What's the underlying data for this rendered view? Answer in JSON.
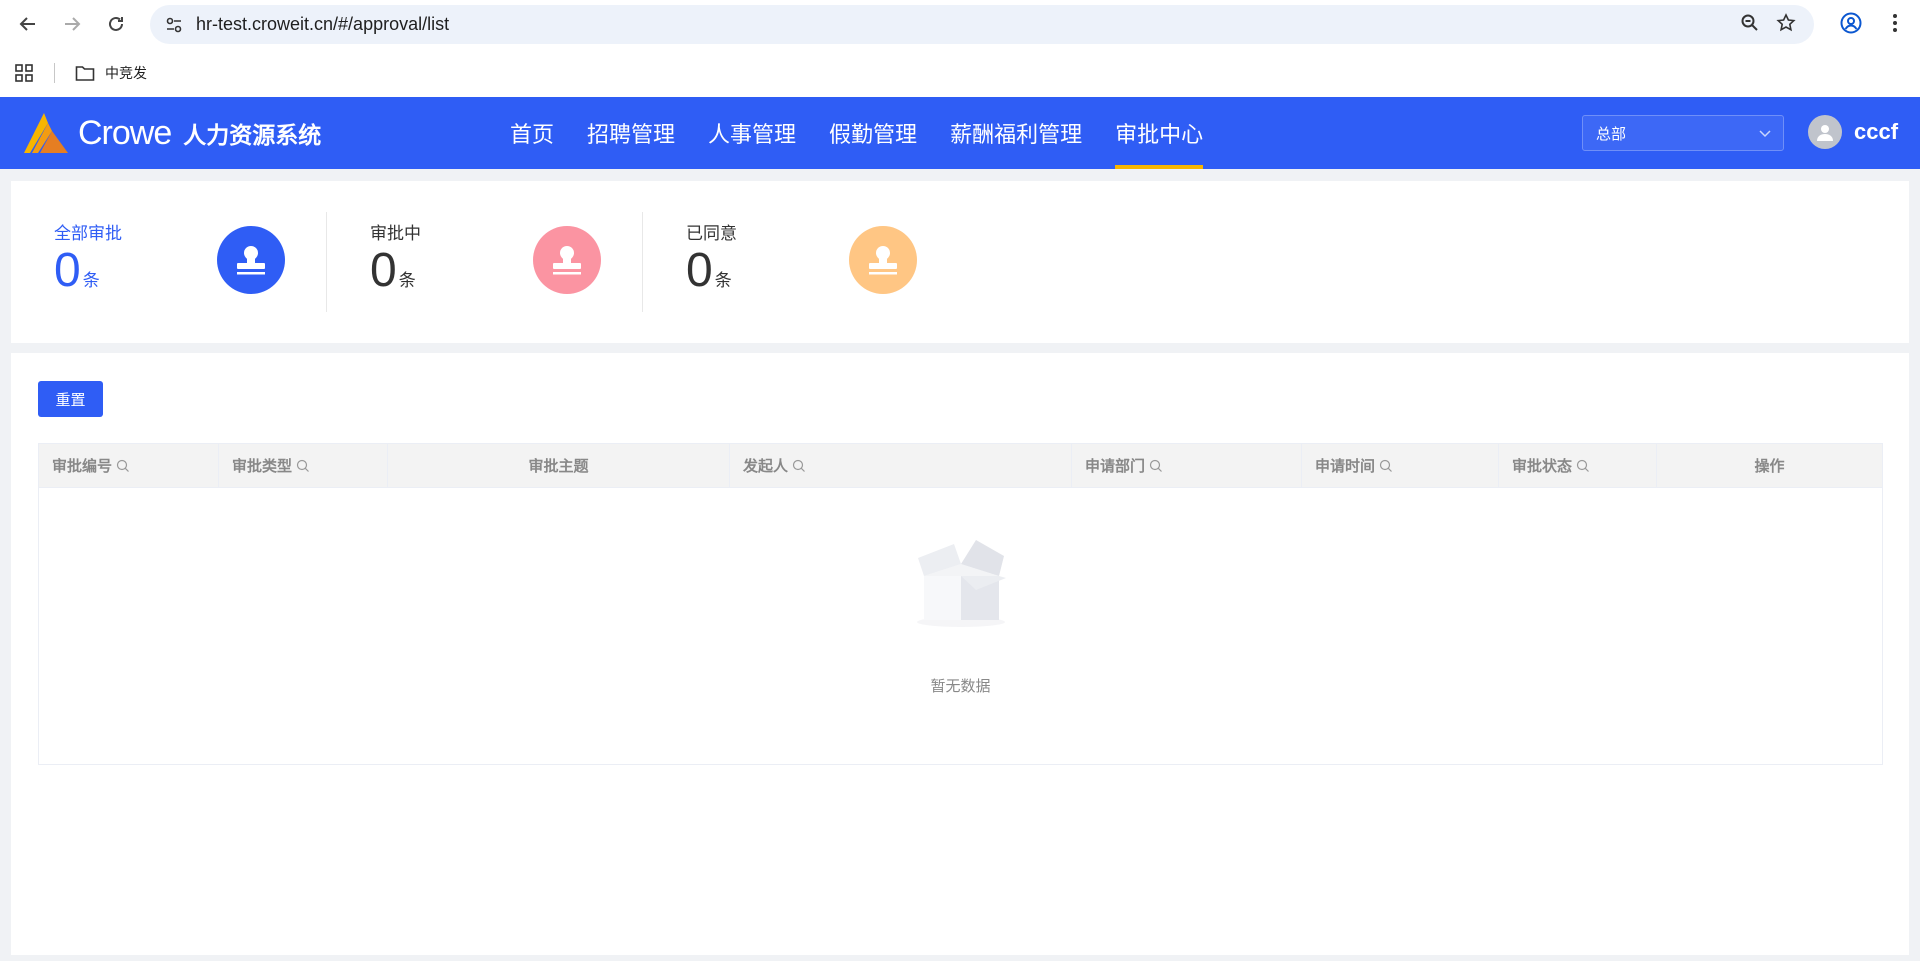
{
  "browser": {
    "url": "hr-test.croweit.cn/#/approval/list",
    "bookmark_folder": "中竞发"
  },
  "header": {
    "logo_text": "Crowe",
    "system_name": "人力资源系统",
    "nav": [
      {
        "label": "首页"
      },
      {
        "label": "招聘管理"
      },
      {
        "label": "人事管理"
      },
      {
        "label": "假勤管理"
      },
      {
        "label": "薪酬福利管理"
      },
      {
        "label": "审批中心",
        "active": true
      }
    ],
    "org_select": "总部",
    "user_name": "cccf"
  },
  "stats": [
    {
      "label": "全部审批",
      "count": "0",
      "unit": "条",
      "color": "#2f5df5"
    },
    {
      "label": "审批中",
      "count": "0",
      "unit": "条",
      "color": "#fb94a2"
    },
    {
      "label": "已同意",
      "count": "0",
      "unit": "条",
      "color": "#ffc684"
    }
  ],
  "toolbar": {
    "reset_label": "重置"
  },
  "table": {
    "columns": [
      {
        "label": "审批编号",
        "searchable": true
      },
      {
        "label": "审批类型",
        "searchable": true
      },
      {
        "label": "审批主题",
        "searchable": false
      },
      {
        "label": "发起人",
        "searchable": true
      },
      {
        "label": "申请部门",
        "searchable": true
      },
      {
        "label": "申请时间",
        "searchable": true
      },
      {
        "label": "审批状态",
        "searchable": true
      },
      {
        "label": "操作",
        "searchable": false
      }
    ],
    "empty_text": "暂无数据"
  },
  "colors": {
    "primary": "#2f5df5",
    "nav_active_underline": "#f7b500"
  }
}
